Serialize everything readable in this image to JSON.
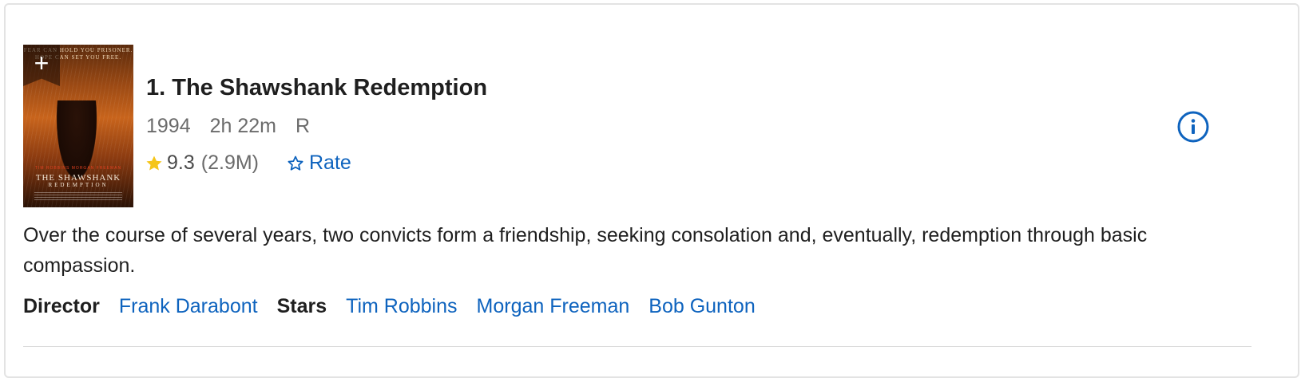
{
  "movie": {
    "title": "1. The Shawshank Redemption",
    "year": "1994",
    "runtime": "2h 22m",
    "certificate": "R",
    "rating": "9.3",
    "vote_count": "(2.9M)",
    "rate_label": "Rate",
    "plot": "Over the course of several years, two convicts form a friendship, seeking consolation and, eventually, redemption through basic compassion.",
    "poster": {
      "tagline": "FEAR CAN HOLD YOU PRISONER. HOPE CAN SET YOU FREE.",
      "actors": "TIM ROBBINS   MORGAN FREEMAN",
      "title": "THE SHAWSHANK",
      "subtitle": "REDEMPTION"
    }
  },
  "credits": {
    "director_label": "Director",
    "director": "Frank Darabont",
    "stars_label": "Stars",
    "stars": [
      "Tim Robbins",
      "Morgan Freeman",
      "Bob Gunton"
    ]
  },
  "icons": {
    "add": "plus-icon",
    "star": "star-icon",
    "rate": "star-outline-icon",
    "info": "info-icon"
  },
  "colors": {
    "link": "#0e63be",
    "star": "#f5c518",
    "text": "#1f1f1f",
    "muted": "#6b6b6b"
  }
}
